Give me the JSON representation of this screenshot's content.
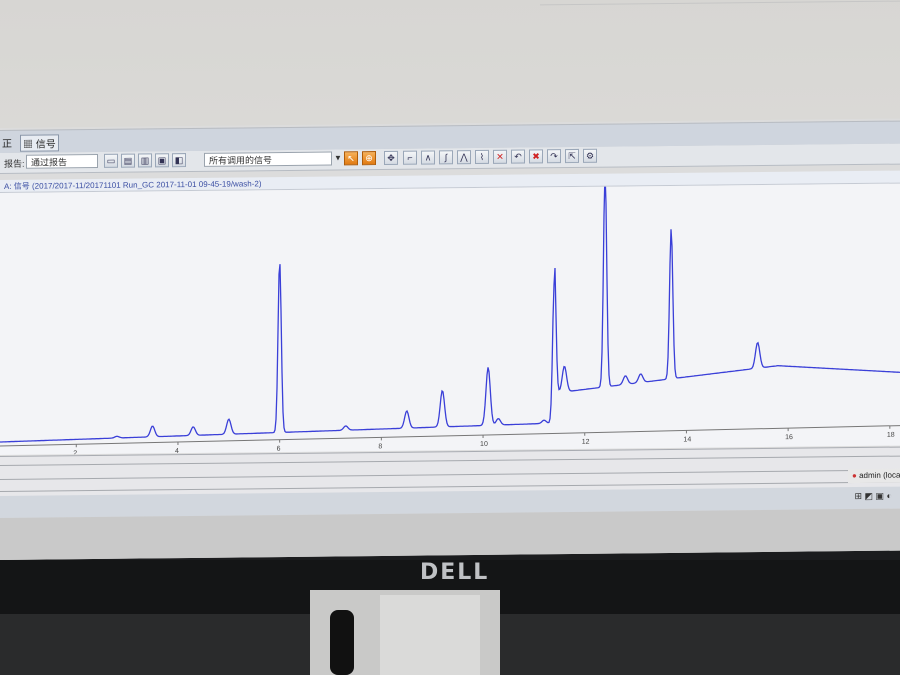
{
  "menu": {
    "item1": "正",
    "item2": "信号"
  },
  "toolbar": {
    "report_label": "报告:",
    "report_value": "通过报告",
    "signal_select_value": "所有调用的信号"
  },
  "tab": {
    "title": "A: 信号 (2017/2017-11/20171101 Run_GC 2017-11-01 09-45-19/wash-2)"
  },
  "x_ticks": [
    "2",
    "4",
    "6",
    "8",
    "10",
    "12",
    "14",
    "16",
    "18"
  ],
  "status": {
    "admin": "admin (loca"
  },
  "monitor": {
    "logo": "DELL"
  },
  "colors": {
    "trace": "#3a3fd8",
    "orange_button": "#e07a12"
  },
  "chart_data": {
    "type": "line",
    "x_ticks": [
      2,
      4,
      6,
      8,
      10,
      12,
      14,
      16,
      18
    ],
    "xlim": [
      0.5,
      18.2
    ],
    "ylim": [
      0,
      100
    ],
    "peaks": [
      {
        "x": 2.8,
        "y": 0.8
      },
      {
        "x": 3.5,
        "y": 5
      },
      {
        "x": 4.3,
        "y": 4
      },
      {
        "x": 5.0,
        "y": 7
      },
      {
        "x": 6.0,
        "y": 80
      },
      {
        "x": 7.3,
        "y": 2
      },
      {
        "x": 8.5,
        "y": 8
      },
      {
        "x": 9.2,
        "y": 17
      },
      {
        "x": 10.1,
        "y": 27
      },
      {
        "x": 10.3,
        "y": 3
      },
      {
        "x": 11.2,
        "y": 1.5
      },
      {
        "x": 11.4,
        "y": 65
      },
      {
        "x": 11.6,
        "y": 12
      },
      {
        "x": 12.4,
        "y": 100
      },
      {
        "x": 12.8,
        "y": 4
      },
      {
        "x": 13.1,
        "y": 4
      },
      {
        "x": 13.7,
        "y": 70
      },
      {
        "x": 15.4,
        "y": 12
      }
    ]
  }
}
